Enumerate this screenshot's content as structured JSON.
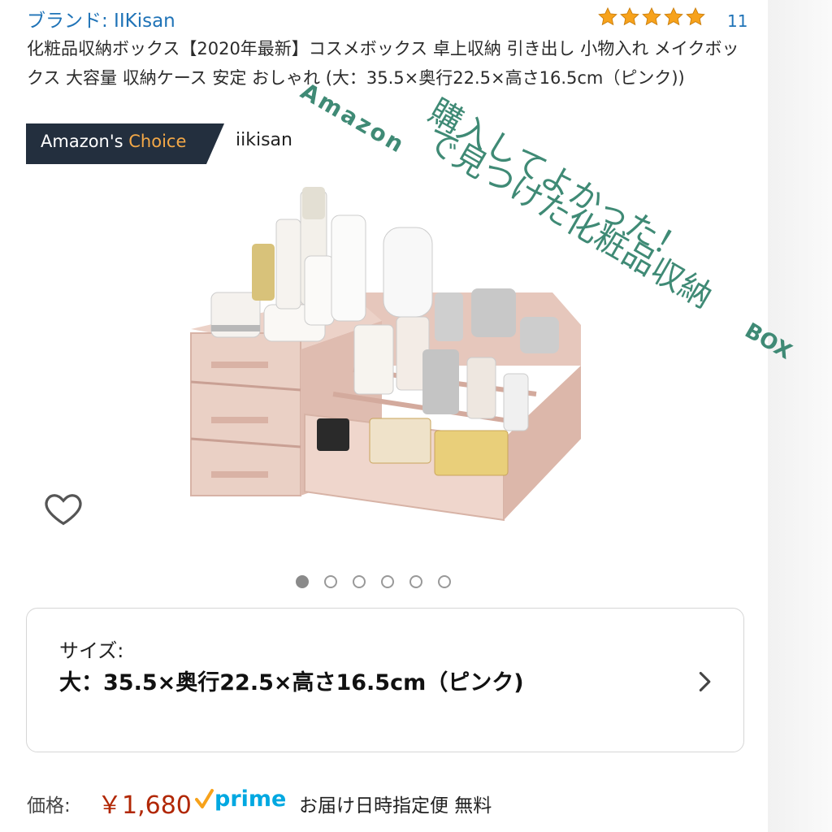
{
  "brand_line": "ブランド: IIKisan",
  "rating": {
    "stars": 5,
    "review_count": "11",
    "star_color": "#f7a21b"
  },
  "title_text": "化粧品収納ボックス【2020年最新】コスメボックス 卓上収納 引き出し 小物入れ メイクボックス 大容量 収納ケース 安定 おしゃれ (大：35.5×奥行22.5×高さ16.5cm（ピンク))",
  "badge": {
    "prefix": "Amazon's ",
    "accent": "Choice",
    "bg_color": "#232f3e",
    "accent_color": "#f3a847"
  },
  "seller": "iikisan",
  "overlay": {
    "amazon_word": "Amazon",
    "line1": "で見つけた化粧品収納",
    "box_word": "BOX",
    "line2": "購入してよかった！",
    "ink_color": "#3f8a75"
  },
  "product_image": {
    "icon": "cosmetic-organizer-image",
    "body_color": "#ecd2c8"
  },
  "wishlist": {
    "icon": "heart-icon"
  },
  "carousel": {
    "count": 6,
    "active_index": 0
  },
  "size_selector": {
    "label": "サイズ:",
    "value": "大：35.5×奥行22.5×高さ16.5cm（ピンク)",
    "icon": "chevron-right-icon"
  },
  "price": {
    "label": "価格:",
    "amount": "￥1,680",
    "prime_text": "prime",
    "prime_color": "#00a8e1",
    "delivery": "お届け日時指定便 無料"
  }
}
